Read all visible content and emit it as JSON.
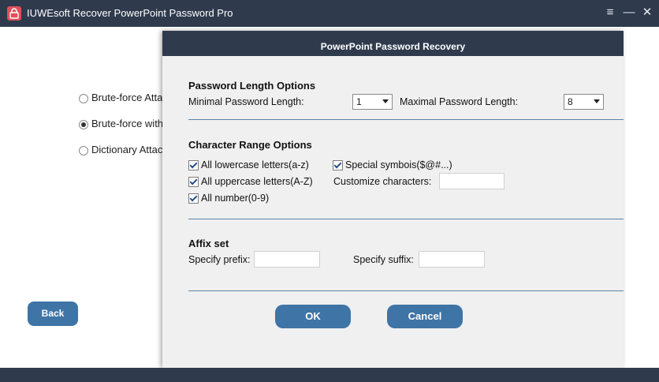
{
  "window": {
    "title": "IUWEsoft Recover PowerPoint Password Pro",
    "menu_glyph": "≡",
    "minimize_glyph": "—",
    "close_glyph": "✕"
  },
  "background": {
    "options": [
      {
        "label": "Brute-force Attac",
        "selected": false
      },
      {
        "label": "Brute-force with",
        "selected": true
      },
      {
        "label": "Dictionary Attack",
        "selected": false
      }
    ],
    "back_label": "Back"
  },
  "dialog": {
    "title": "PowerPoint Password Recovery",
    "length": {
      "title": "Password Length Options",
      "min_label": "Minimal Password Length:",
      "min_value": "1",
      "max_label": "Maximal Password Length:",
      "max_value": "8"
    },
    "charset": {
      "title": "Character Range Options",
      "lowercase": {
        "label": "All lowercase letters(a-z)",
        "checked": true
      },
      "uppercase": {
        "label": "All uppercase letters(A-Z)",
        "checked": true
      },
      "numbers": {
        "label": "All number(0-9)",
        "checked": true
      },
      "special": {
        "label": "Special symbois($@#...)",
        "checked": true
      },
      "custom_label": "Customize characters:",
      "custom_value": ""
    },
    "affix": {
      "title": "Affix set",
      "prefix_label": "Specify prefix:",
      "prefix_value": "",
      "suffix_label": "Specify suffix:",
      "suffix_value": ""
    },
    "ok_label": "OK",
    "cancel_label": "Cancel"
  },
  "colors": {
    "titlebar": "#2f3a4d",
    "button": "#3f74a6",
    "separator": "#5a83a8",
    "dialog_bg": "#f0f0f0"
  },
  "icons": [
    "lock-app-icon",
    "menu-icon",
    "minimize-icon",
    "close-icon"
  ]
}
